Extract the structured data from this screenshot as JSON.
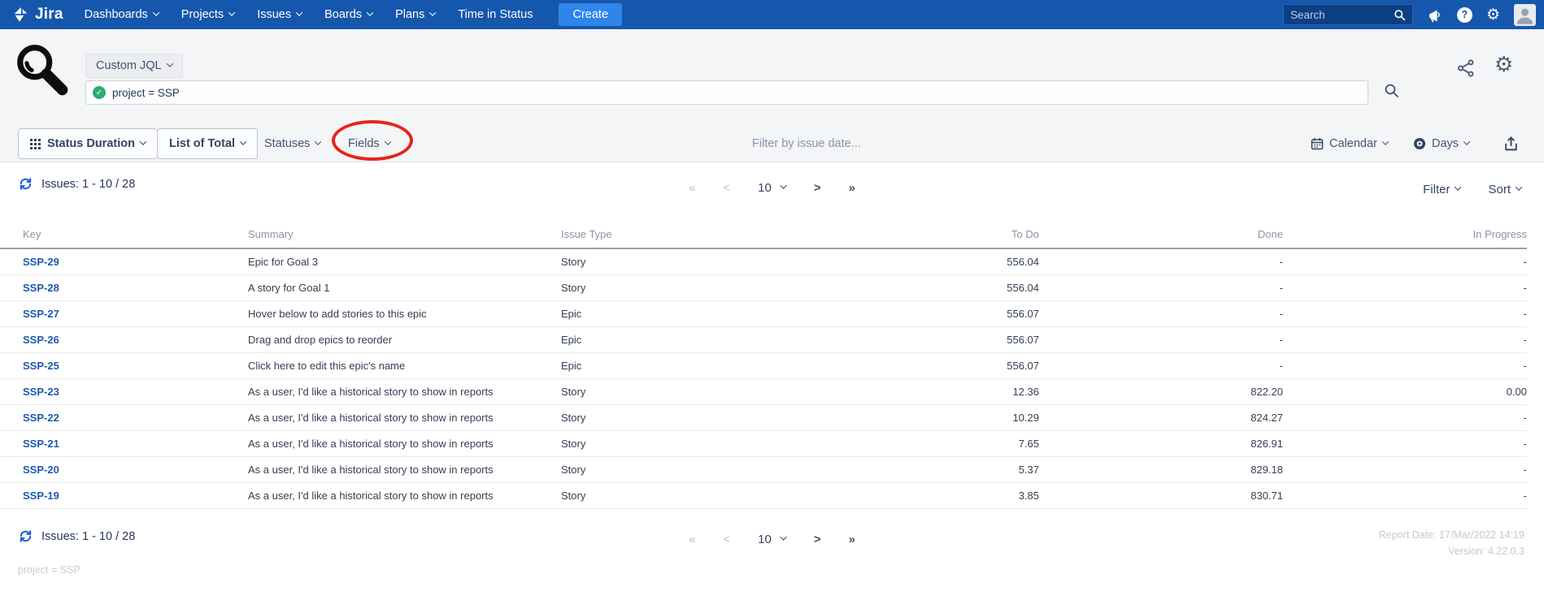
{
  "nav": {
    "brand": "Jira",
    "items": [
      {
        "label": "Dashboards",
        "dropdown": true
      },
      {
        "label": "Projects",
        "dropdown": true
      },
      {
        "label": "Issues",
        "dropdown": true
      },
      {
        "label": "Boards",
        "dropdown": true
      },
      {
        "label": "Plans",
        "dropdown": true
      },
      {
        "label": "Time in Status",
        "dropdown": false
      }
    ],
    "create_label": "Create",
    "search_placeholder": "Search"
  },
  "query": {
    "mode_label": "Custom JQL",
    "jql": "project = SSP"
  },
  "toolbar": {
    "view_button": "Status Duration",
    "total_button": "List of Total",
    "statuses_button": "Statuses",
    "fields_button": "Fields",
    "date_filter_placeholder": "Filter by issue date...",
    "calendar_button": "Calendar",
    "unit_button": "Days"
  },
  "list": {
    "issues_count": "Issues: 1 - 10 / 28",
    "first": "«",
    "prev": "<",
    "next": ">",
    "last": "»",
    "page_size": "10",
    "filter_label": "Filter",
    "sort_label": "Sort"
  },
  "table": {
    "columns": [
      "Key",
      "Summary",
      "Issue Type",
      "To Do",
      "Done",
      "In Progress"
    ],
    "rows": [
      {
        "key": "SSP-29",
        "summary": "Epic for Goal 3",
        "issue_type": "Story",
        "to_do": "556.04",
        "done": "-",
        "in_progress": "-"
      },
      {
        "key": "SSP-28",
        "summary": "A story for Goal 1",
        "issue_type": "Story",
        "to_do": "556.04",
        "done": "-",
        "in_progress": "-"
      },
      {
        "key": "SSP-27",
        "summary": "Hover below to add stories to this epic",
        "issue_type": "Epic",
        "to_do": "556.07",
        "done": "-",
        "in_progress": "-"
      },
      {
        "key": "SSP-26",
        "summary": "Drag and drop epics to reorder",
        "issue_type": "Epic",
        "to_do": "556.07",
        "done": "-",
        "in_progress": "-"
      },
      {
        "key": "SSP-25",
        "summary": "Click here to edit this epic's name",
        "issue_type": "Epic",
        "to_do": "556.07",
        "done": "-",
        "in_progress": "-"
      },
      {
        "key": "SSP-23",
        "summary": "As a user, I'd like a historical story to show in reports",
        "issue_type": "Story",
        "to_do": "12.36",
        "done": "822.20",
        "in_progress": "0.00"
      },
      {
        "key": "SSP-22",
        "summary": "As a user, I'd like a historical story to show in reports",
        "issue_type": "Story",
        "to_do": "10.29",
        "done": "824.27",
        "in_progress": "-"
      },
      {
        "key": "SSP-21",
        "summary": "As a user, I'd like a historical story to show in reports",
        "issue_type": "Story",
        "to_do": "7.65",
        "done": "826.91",
        "in_progress": "-"
      },
      {
        "key": "SSP-20",
        "summary": "As a user, I'd like a historical story to show in reports",
        "issue_type": "Story",
        "to_do": "5.37",
        "done": "829.18",
        "in_progress": "-"
      },
      {
        "key": "SSP-19",
        "summary": "As a user, I'd like a historical story to show in reports",
        "issue_type": "Story",
        "to_do": "3.85",
        "done": "830.71",
        "in_progress": "-"
      }
    ]
  },
  "footer": {
    "issues_count": "Issues: 1 - 10 / 28",
    "report_date": "Report Date: 17/Mar/2022 14:19",
    "version": "Version: 4.22.0.3",
    "jql_echo": "project = SSP"
  },
  "colors": {
    "nav_bg": "#1557ad",
    "create_button": "#2e86ea",
    "link_blue": "#1c5aae",
    "annotation_red": "#e8231a",
    "check_green": "#2bad71"
  }
}
